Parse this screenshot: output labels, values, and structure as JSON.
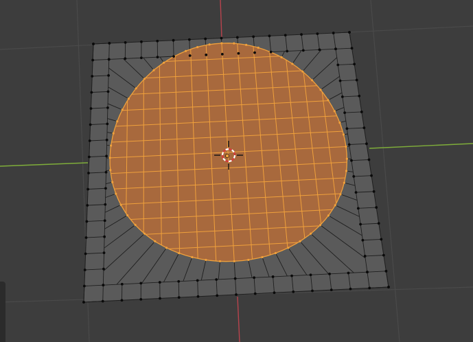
{
  "viewport": {
    "background": "#3d3d3d",
    "grid_color": "#4a4a4a",
    "x_axis_color": "#7fae3a",
    "y_axis_color": "#b8434d"
  },
  "mesh": {
    "face_color": "#5a5a5a",
    "wire_color": "#1e1e1e",
    "vertex_color": "#0a0a0a",
    "selected_face_color": "#a8693d",
    "selected_wire_color": "#f0a13c"
  },
  "cursor": {
    "icon": "3d-cursor-icon",
    "primary_color": "#ffffff",
    "secondary_color": "#d63a3a"
  },
  "origin": {
    "icon": "origin-icon",
    "color": "#f0a13c"
  }
}
